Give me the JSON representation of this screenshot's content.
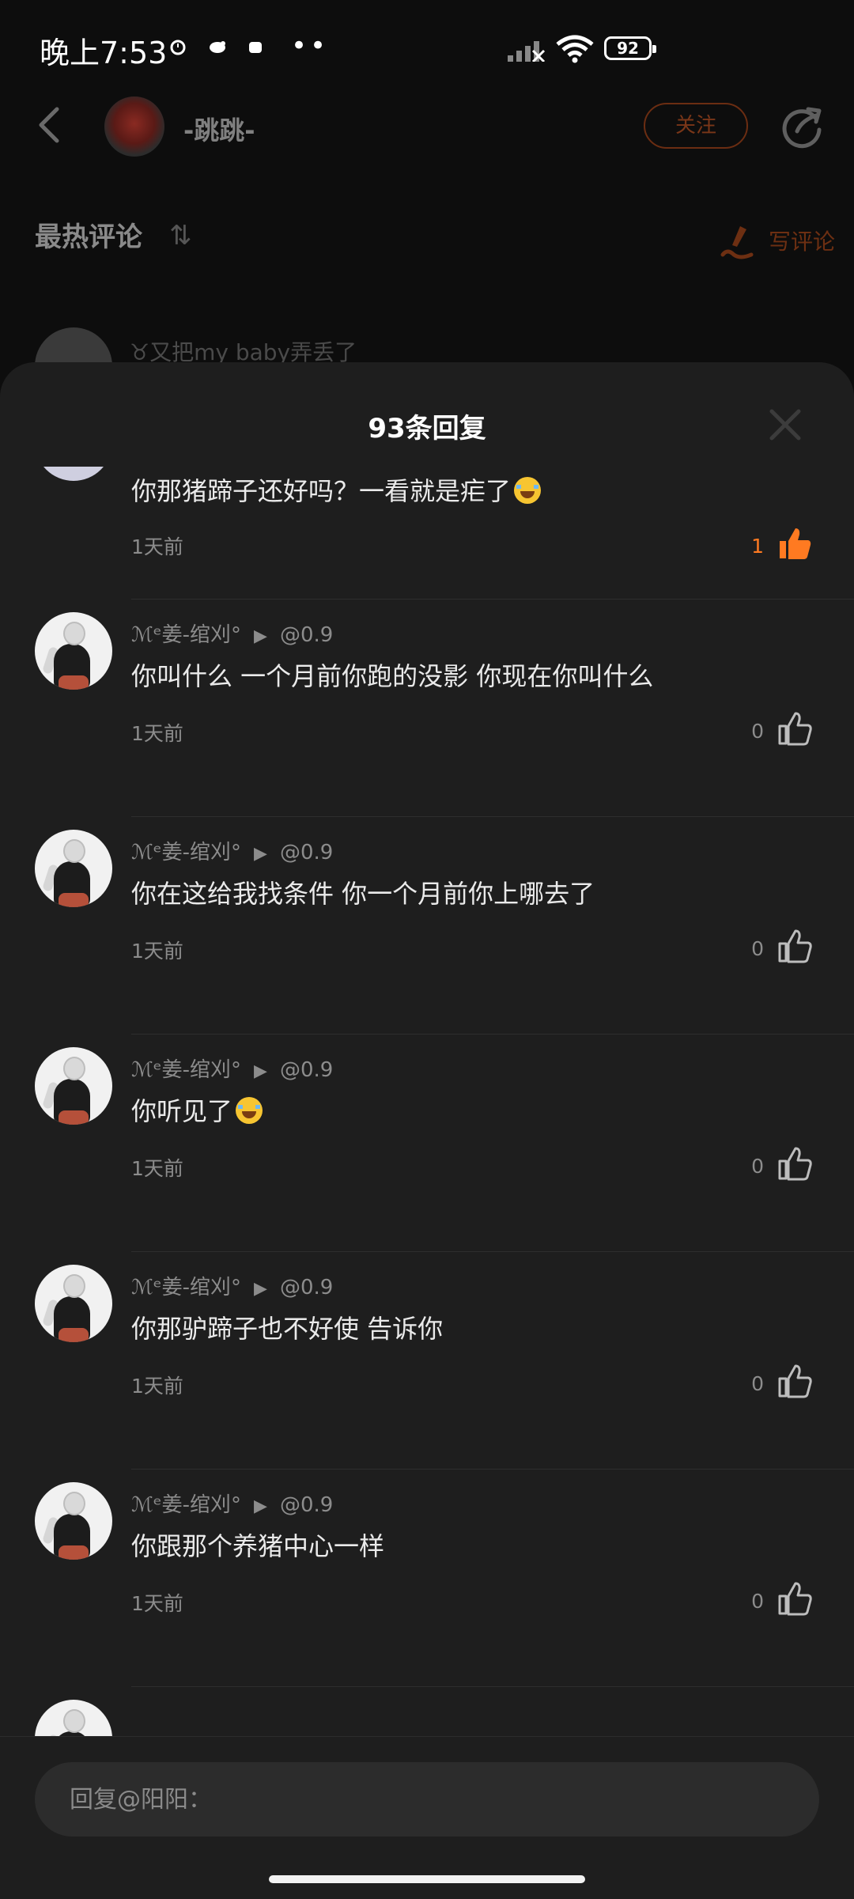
{
  "status_bar": {
    "time": "晚上7:53",
    "notification_icons": [
      "alarm-icon",
      "bird-icon",
      "alarm-icon"
    ],
    "more_dots": "••",
    "battery": "92"
  },
  "background": {
    "author_name": "-跳跳-",
    "follow_label": "关注",
    "section_title": "最热评论",
    "sort_glyph": "⇅",
    "write_comment_label": "写评论",
    "peek_comment_text": "♉又把my baby弄丢了"
  },
  "sheet": {
    "title": "93条回复",
    "partial_reply": {
      "content": "你那猪蹄子还好吗？一看就是疟了",
      "time": "1天前",
      "likes": "1"
    },
    "replies": [
      {
        "user": "ℳᵉ姜-绾刈°",
        "reply_to": "@0.9",
        "content": "你叫什么 一个月前你跑的没影 你现在你叫什么",
        "time": "1天前",
        "likes": "0"
      },
      {
        "user": "ℳᵉ姜-绾刈°",
        "reply_to": "@0.9",
        "content": "你在这给我找条件 你一个月前你上哪去了",
        "time": "1天前",
        "likes": "0"
      },
      {
        "user": "ℳᵉ姜-绾刈°",
        "reply_to": "@0.9",
        "content": "你听见了",
        "time": "1天前",
        "likes": "0"
      },
      {
        "user": "ℳᵉ姜-绾刈°",
        "reply_to": "@0.9",
        "content": "你那驴蹄子也不好使 告诉你",
        "time": "1天前",
        "likes": "0"
      },
      {
        "user": "ℳᵉ姜-绾刈°",
        "reply_to": "@0.9",
        "content": "你跟那个养猪中心一样",
        "time": "1天前",
        "likes": "0"
      }
    ]
  },
  "reply_input": {
    "placeholder": "回复@阳阳："
  },
  "colors": {
    "accent": "#ff7a21",
    "sheet_bg": "#1e1e1e",
    "page_bg": "#0d0d0d"
  }
}
